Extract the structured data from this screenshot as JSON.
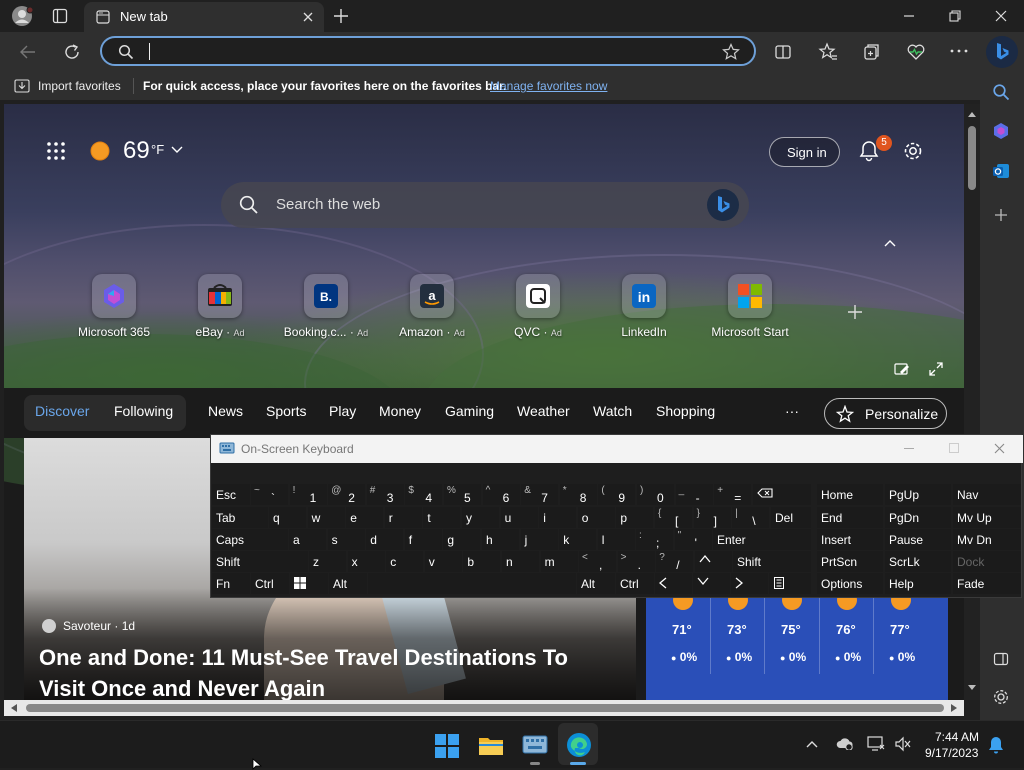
{
  "browser": {
    "tab_title": "New tab",
    "address_value": "",
    "favorites_bar": {
      "import_label": "Import favorites",
      "hint_text": "For quick access, place your favorites here on the favorites bar.",
      "manage_link": "Manage favorites now"
    }
  },
  "newtab": {
    "weather": {
      "temp": "69",
      "unit": "°F"
    },
    "sign_in": "Sign in",
    "notification_count": "5",
    "search_placeholder": "Search the web",
    "quick_links": [
      {
        "label": "Microsoft 365",
        "ad": ""
      },
      {
        "label": "eBay",
        "ad": "Ad"
      },
      {
        "label": "Booking.c...",
        "ad": "Ad"
      },
      {
        "label": "Amazon",
        "ad": "Ad"
      },
      {
        "label": "QVC",
        "ad": "Ad"
      },
      {
        "label": "LinkedIn",
        "ad": ""
      },
      {
        "label": "Microsoft Start",
        "ad": ""
      }
    ],
    "nav": {
      "discover": "Discover",
      "following": "Following",
      "items": [
        "News",
        "Sports",
        "Play",
        "Money",
        "Gaming",
        "Weather",
        "Watch",
        "Shopping"
      ],
      "more": "···",
      "personalize": "Personalize"
    },
    "article": {
      "source": "Savoteur · 1d",
      "headline_line1": "One and Done: 11 Must-See Travel Destinations To",
      "headline_line2": "Visit Once and Never Again"
    },
    "forecast": [
      {
        "temp": "71°",
        "precip": "0%"
      },
      {
        "temp": "73°",
        "precip": "0%"
      },
      {
        "temp": "75°",
        "precip": "0%"
      },
      {
        "temp": "76°",
        "precip": "0%"
      },
      {
        "temp": "77°",
        "precip": "0%"
      }
    ]
  },
  "osk": {
    "title": "On-Screen Keyboard",
    "keys": {
      "esc": "Esc",
      "tab": "Tab",
      "caps": "Caps",
      "shift_l": "Shift",
      "fn": "Fn",
      "ctrl_l": "Ctrl",
      "alt_l": "Alt",
      "del": "Del",
      "enter": "Enter",
      "shift_r": "Shift",
      "alt_r": "Alt",
      "ctrl_r": "Ctrl",
      "home": "Home",
      "pgup": "PgUp",
      "nav": "Nav",
      "end": "End",
      "pgdn": "PgDn",
      "mvup": "Mv Up",
      "insert": "Insert",
      "pause": "Pause",
      "mvdn": "Mv Dn",
      "prtscn": "PrtScn",
      "scrlk": "ScrLk",
      "dock": "Dock",
      "options": "Options",
      "help": "Help",
      "fade": "Fade",
      "row1": [
        [
          "~",
          "`"
        ],
        [
          "!",
          "1"
        ],
        [
          "@",
          "2"
        ],
        [
          "#",
          "3"
        ],
        [
          "$",
          "4"
        ],
        [
          "%",
          "5"
        ],
        [
          "^",
          "6"
        ],
        [
          "&",
          "7"
        ],
        [
          "*",
          "8"
        ],
        [
          "(",
          "9"
        ],
        [
          ")",
          "0"
        ],
        [
          "_",
          "-"
        ],
        [
          "+",
          "="
        ]
      ],
      "row2": [
        "q",
        "w",
        "e",
        "r",
        "t",
        "y",
        "u",
        "i",
        "o",
        "p"
      ],
      "row2_sym": [
        [
          "{",
          "["
        ],
        [
          "}",
          "]"
        ],
        [
          "|",
          "\\"
        ]
      ],
      "row3": [
        "a",
        "s",
        "d",
        "f",
        "g",
        "h",
        "j",
        "k",
        "l"
      ],
      "row3_sym": [
        [
          ":",
          ";"
        ],
        [
          "\"",
          "'"
        ]
      ],
      "row4": [
        "z",
        "x",
        "c",
        "v",
        "b",
        "n",
        "m"
      ],
      "row4_sym": [
        [
          "<",
          ","
        ],
        [
          ">",
          "."
        ],
        [
          "?",
          "/"
        ]
      ]
    }
  },
  "taskbar": {
    "time": "7:44 AM",
    "date": "9/17/2023"
  }
}
